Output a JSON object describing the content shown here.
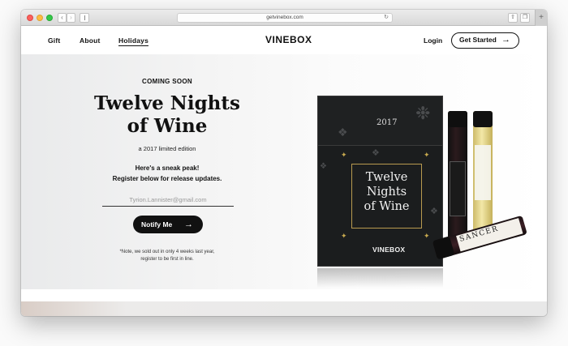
{
  "browser": {
    "url": "getvinebox.com"
  },
  "header": {
    "nav": [
      "Gift",
      "About",
      "Holidays"
    ],
    "logo": "VINEBOX",
    "login": "Login",
    "cta": "Get Started"
  },
  "hero": {
    "eyebrow": "COMING SOON",
    "title_line1": "Twelve Nights",
    "title_line2": "of Wine",
    "edition": "a 2017 limited edition",
    "sneak_line1": "Here's a sneak peak!",
    "sneak_line2": "Register below for release updates.",
    "email_placeholder": "Tyrion.Lannister@gmail.com",
    "notify_label": "Notify Me",
    "footnote_line1": "*Note, we sold out in only 4 weeks last year,",
    "footnote_line2": "register to be first in line."
  },
  "product_image": {
    "box_year": "2017",
    "box_title_line1": "Twelve",
    "box_title_line2": "Nights",
    "box_title_line3": "of Wine",
    "box_logo": "VINEBOX",
    "bottle_label": "SANCER"
  },
  "colors": {
    "accent": "#111111",
    "gold": "#c7a94f",
    "box": "#1b1d1e"
  }
}
